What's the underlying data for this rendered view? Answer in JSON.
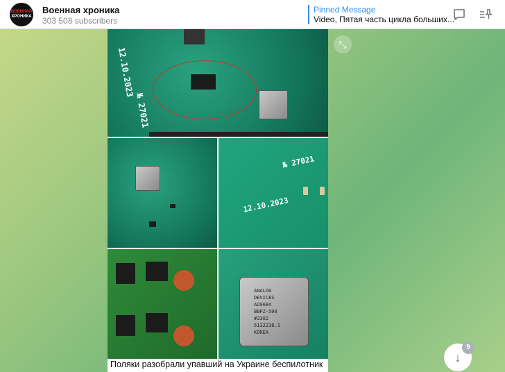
{
  "header": {
    "channel_name": "Военная хроника",
    "subscribers": "303 508 subscribers",
    "avatar_text": [
      "ВОЕННАЯ",
      "ХРОНИКА"
    ],
    "pinned": {
      "label": "Pinned Message",
      "text": "Video, Пятая часть цикла больших..."
    },
    "icons": [
      "comments-icon",
      "pinned-list-icon"
    ]
  },
  "message": {
    "caption": "Поляки разобрали упавший на Украине беспилотник",
    "photo_lettering": {
      "date": "12.10.2023",
      "serial": "№ 27021",
      "chip": [
        "ANALOG",
        "DEVICES",
        "AD9684",
        "BBPZ-500",
        "#2302",
        "6132238.1",
        "KOREA"
      ]
    }
  },
  "scroll": {
    "unread_count": "9"
  },
  "colors": {
    "accent": "#3390ec"
  }
}
